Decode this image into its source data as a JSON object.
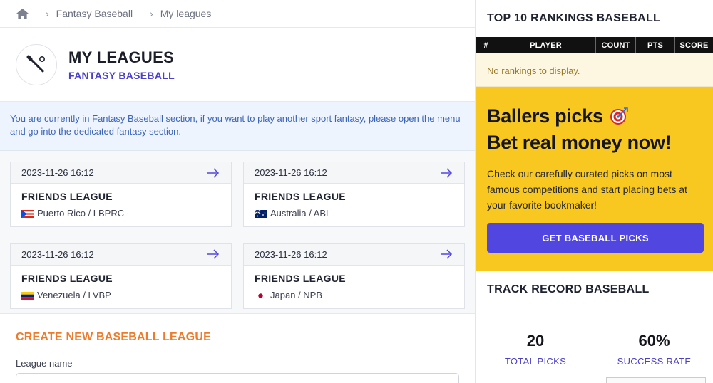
{
  "breadcrumb": {
    "items": [
      "Fantasy Baseball",
      "My leagues"
    ]
  },
  "header": {
    "title": "MY LEAGUES",
    "subtitle": "FANTASY BASEBALL"
  },
  "notice": {
    "text": "You are currently in Fantasy Baseball section, if you want to play another sport fantasy, please open the menu and go into the dedicated fantasy section."
  },
  "leagues": [
    {
      "date": "2023-11-26 16:12",
      "name": "FRIENDS LEAGUE",
      "location": "Puerto Rico / LBPRC",
      "flag": "puerto-rico-flag-icon"
    },
    {
      "date": "2023-11-26 16:12",
      "name": "FRIENDS LEAGUE",
      "location": "Australia / ABL",
      "flag": "australia-flag-icon"
    },
    {
      "date": "2023-11-26 16:12",
      "name": "FRIENDS LEAGUE",
      "location": "Venezuela / LVBP",
      "flag": "venezuela-flag-icon"
    },
    {
      "date": "2023-11-26 16:12",
      "name": "FRIENDS LEAGUE",
      "location": "Japan / NPB",
      "flag": "japan-flag-icon"
    }
  ],
  "create": {
    "title": "CREATE NEW BASEBALL LEAGUE",
    "field_label": "League name",
    "field_value": ""
  },
  "rankings": {
    "title": "TOP 10 RANKINGS BASEBALL",
    "columns": [
      "#",
      "PLAYER",
      "COUNT",
      "PTS",
      "SCORE"
    ],
    "empty_text": "No rankings to display."
  },
  "promo": {
    "title_line1": "Ballers picks",
    "title_line2": "Bet real money now!",
    "text": "Check our carefully curated picks on most famous competitions and start placing bets at your favorite bookmaker!",
    "button": "GET BASEBALL PICKS",
    "icon": "target-icon"
  },
  "track": {
    "title": "TRACK RECORD BASEBALL",
    "stats": [
      {
        "value": "20",
        "label": "TOTAL PICKS"
      },
      {
        "value": "60%",
        "label": "SUCCESS RATE"
      }
    ]
  },
  "colors": {
    "accent": "#4b41c8",
    "orange": "#f07a2a",
    "promo_bg": "#f8c820",
    "button": "#5147e0"
  }
}
